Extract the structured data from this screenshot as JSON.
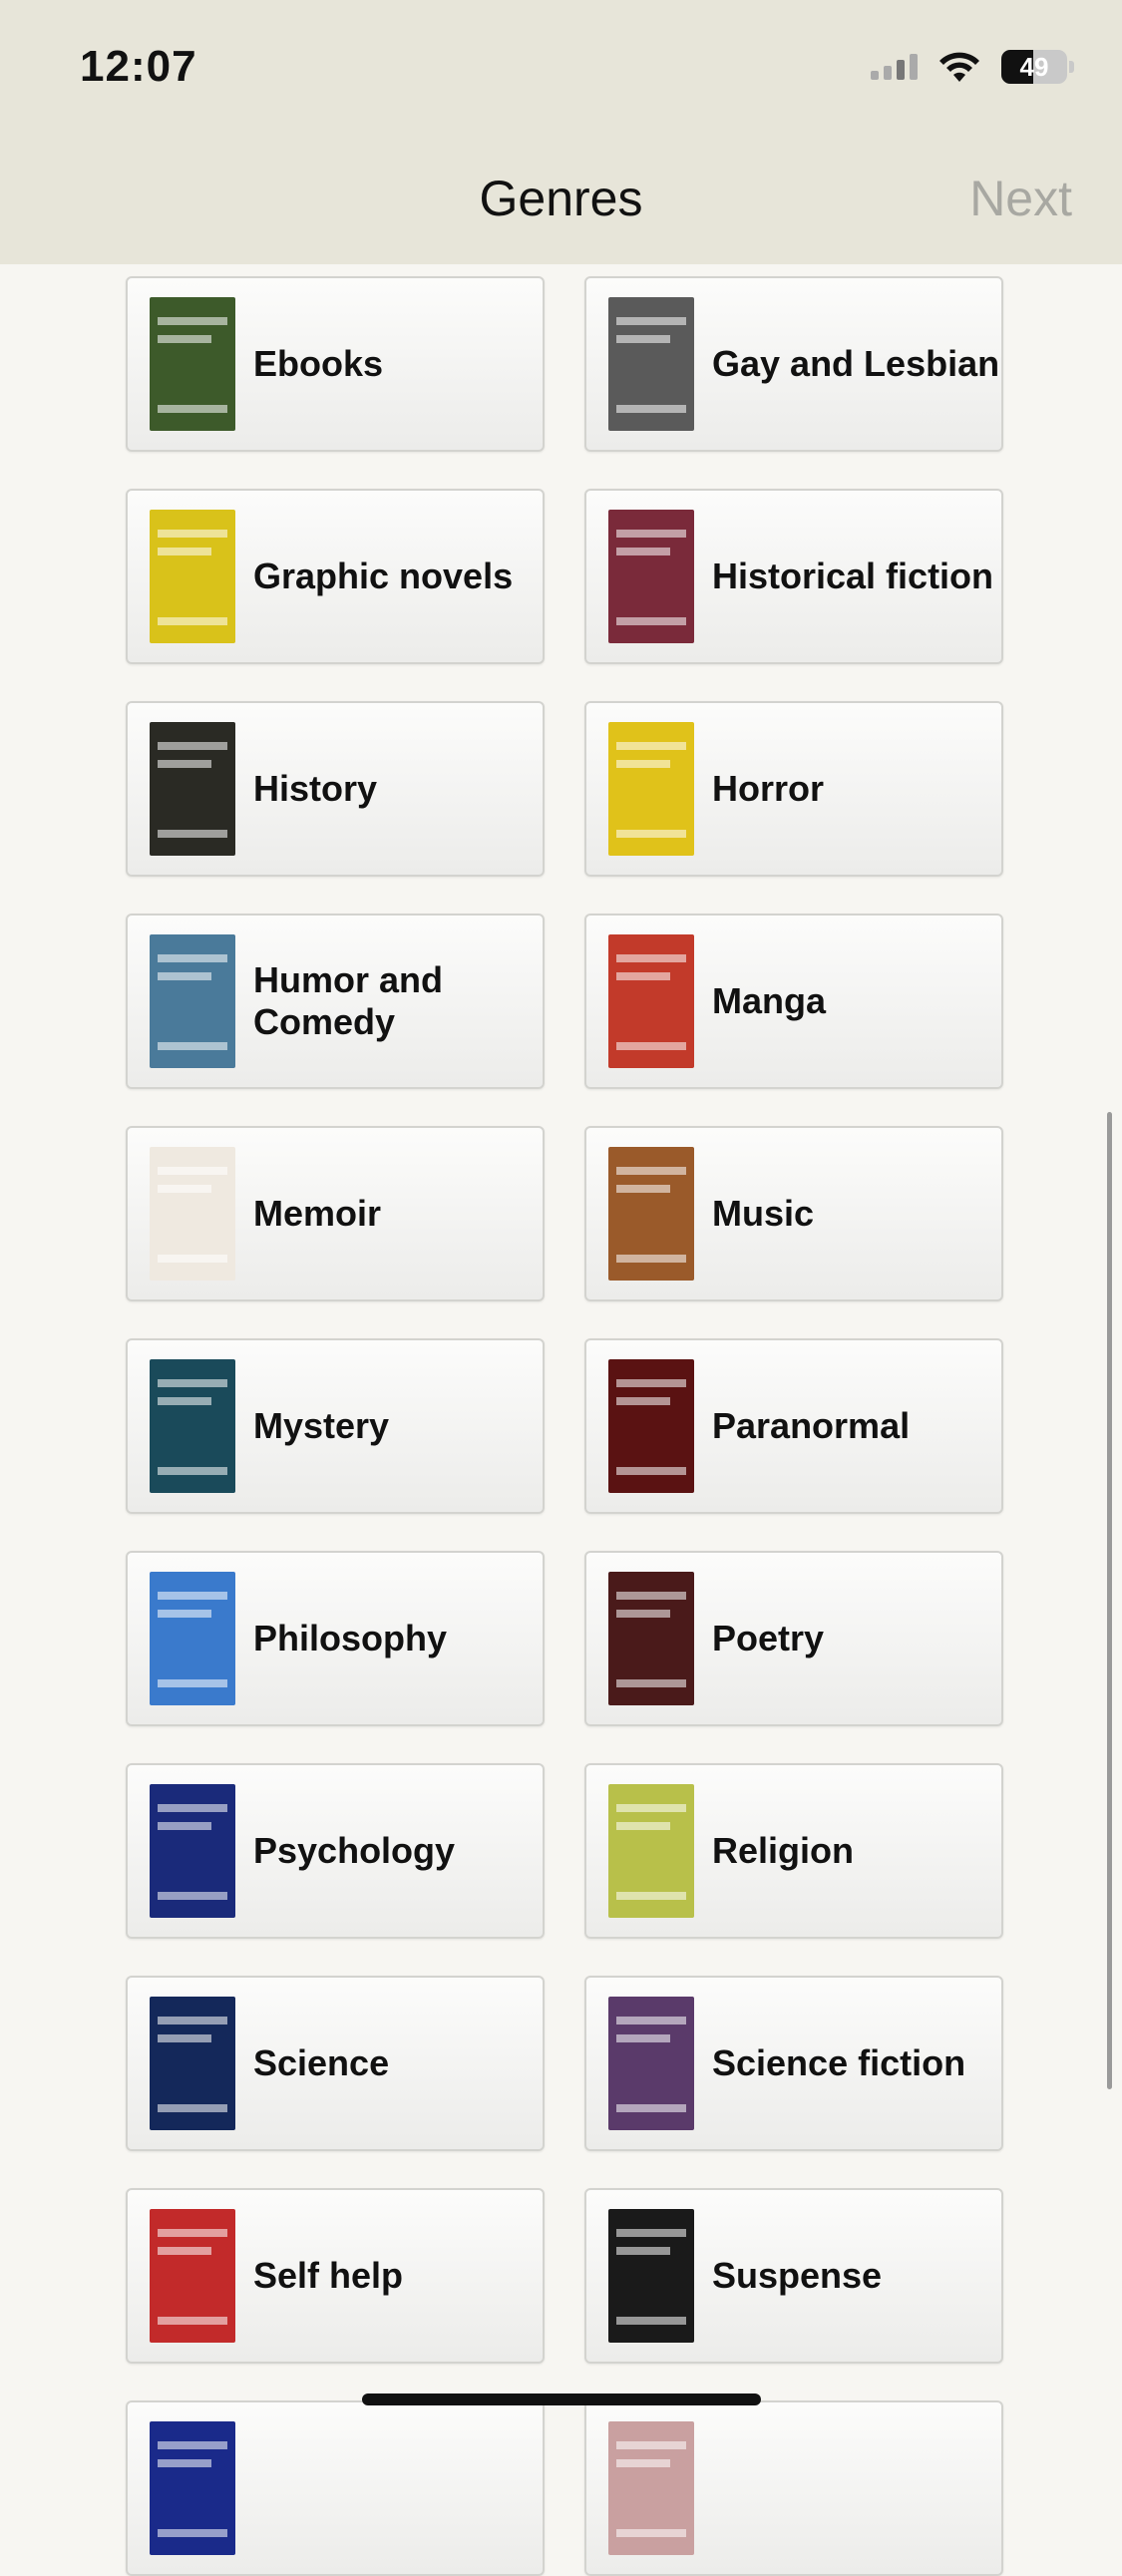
{
  "status": {
    "time": "12:07",
    "battery": "49",
    "battery_level": 0.49
  },
  "nav": {
    "title": "Genres",
    "next_label": "Next"
  },
  "genres": [
    {
      "label": "Ebooks",
      "cover_color": "#3d5a2a"
    },
    {
      "label": "Gay and Lesbian",
      "cover_color": "#5a5a5a"
    },
    {
      "label": "Graphic novels",
      "cover_color": "#d9c21a"
    },
    {
      "label": "Historical fiction",
      "cover_color": "#7a2a3a"
    },
    {
      "label": "History",
      "cover_color": "#2a2a24"
    },
    {
      "label": "Horror",
      "cover_color": "#e0c21a"
    },
    {
      "label": "Humor and Comedy",
      "cover_color": "#4a7a9a"
    },
    {
      "label": "Manga",
      "cover_color": "#c23a2a"
    },
    {
      "label": "Memoir",
      "cover_color": "#efe9e0"
    },
    {
      "label": "Music",
      "cover_color": "#9a5a2a"
    },
    {
      "label": "Mystery",
      "cover_color": "#1a4a5a"
    },
    {
      "label": "Paranormal",
      "cover_color": "#5a1212"
    },
    {
      "label": "Philosophy",
      "cover_color": "#3a7acc"
    },
    {
      "label": "Poetry",
      "cover_color": "#4a1a1a"
    },
    {
      "label": "Psychology",
      "cover_color": "#1a2a7a"
    },
    {
      "label": "Religion",
      "cover_color": "#b8c04a"
    },
    {
      "label": "Science",
      "cover_color": "#14285a"
    },
    {
      "label": "Science fiction",
      "cover_color": "#5a3a6a"
    },
    {
      "label": "Self help",
      "cover_color": "#c22a2a"
    },
    {
      "label": "Suspense",
      "cover_color": "#1a1a1a"
    },
    {
      "label": "",
      "cover_color": "#1a2a8a"
    },
    {
      "label": "",
      "cover_color": "#c9a0a0"
    }
  ]
}
